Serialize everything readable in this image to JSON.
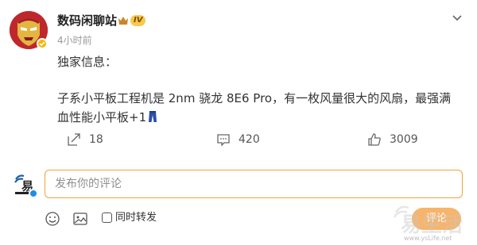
{
  "post": {
    "author": "数码闲聊站",
    "level_badge": "IV",
    "timestamp": "4小时前",
    "line1": "独家信息：",
    "line2": "子系小平板工程机是 2nm 骁龙 8E6 Pro，有一枚风量很大的风扇，最强满血性能小平板+1",
    "emoji": "jeans-emoji"
  },
  "actions": {
    "repost_count": "18",
    "comment_count": "420",
    "like_count": "3009"
  },
  "composer": {
    "placeholder": "发布你的评论",
    "repost_label": "同时转发",
    "repost_checked": false,
    "submit_label": "评论"
  },
  "watermark": {
    "text": "易生活",
    "url": "www.ysLife.net"
  },
  "colors": {
    "accent": "#f0a23a",
    "submit_bg": "#f7b46b",
    "verify_gold": "#f7b500",
    "verify_blue": "#1c8ee6"
  }
}
